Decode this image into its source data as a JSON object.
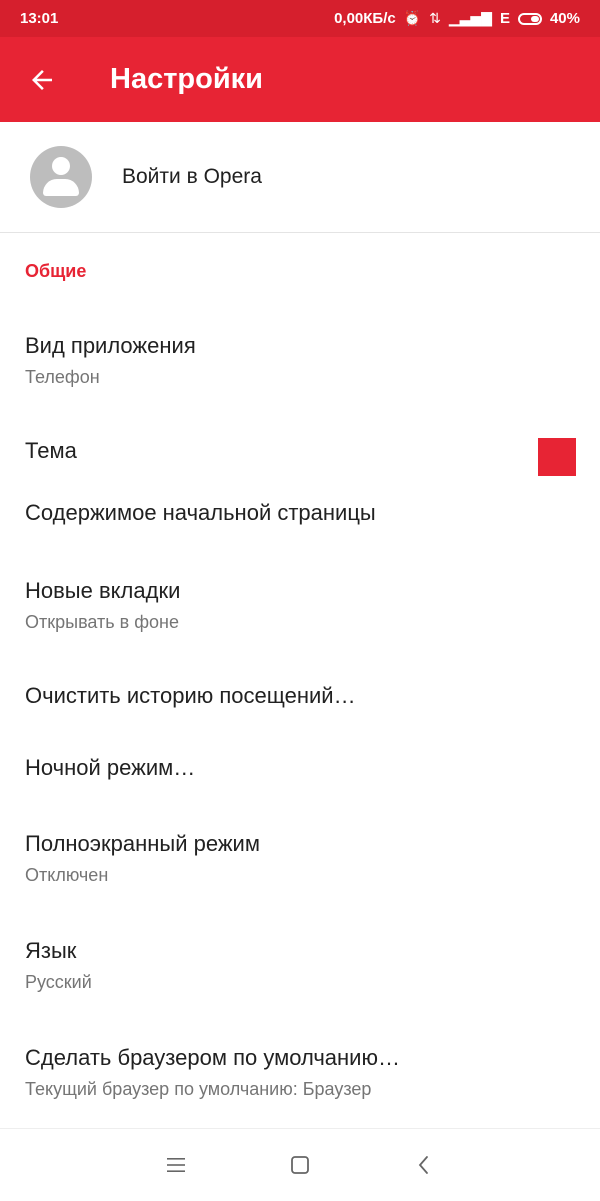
{
  "status_bar": {
    "time": "13:01",
    "speed": "0,00КБ/с",
    "network_type": "E",
    "battery": "40%",
    "battery_level": 0.4,
    "icons": [
      "alarm-icon",
      "data-transfer-icon",
      "signal-icon",
      "battery-icon"
    ]
  },
  "app_bar": {
    "title": "Настройки",
    "back_icon": "arrow-back-icon"
  },
  "account": {
    "label": "Войти в Opera",
    "avatar_icon": "account-avatar-icon"
  },
  "section": {
    "title": "Общие"
  },
  "settings": [
    {
      "title": "Вид приложения",
      "subtitle": "Телефон"
    },
    {
      "title": "Тема",
      "swatch_color": "#e72434"
    },
    {
      "title": "Содержимое начальной страницы"
    },
    {
      "title": "Новые вкладки",
      "subtitle": "Открывать в фоне"
    },
    {
      "title": "Очистить историю посещений…"
    },
    {
      "title": "Ночной режим…"
    },
    {
      "title": "Полноэкранный режим",
      "subtitle": "Отключен"
    },
    {
      "title": "Язык",
      "subtitle": "Русский"
    },
    {
      "title": "Сделать браузером по умолчанию…",
      "subtitle": "Текущий браузер по умолчанию: Браузер"
    }
  ],
  "nav_bar": {
    "icons": [
      "menu-icon",
      "home-square-icon",
      "back-chevron-icon"
    ]
  },
  "colors": {
    "accent": "#e72434",
    "status_bar": "#d61f2d",
    "primary_text": "#212121",
    "secondary_text": "#757575"
  }
}
